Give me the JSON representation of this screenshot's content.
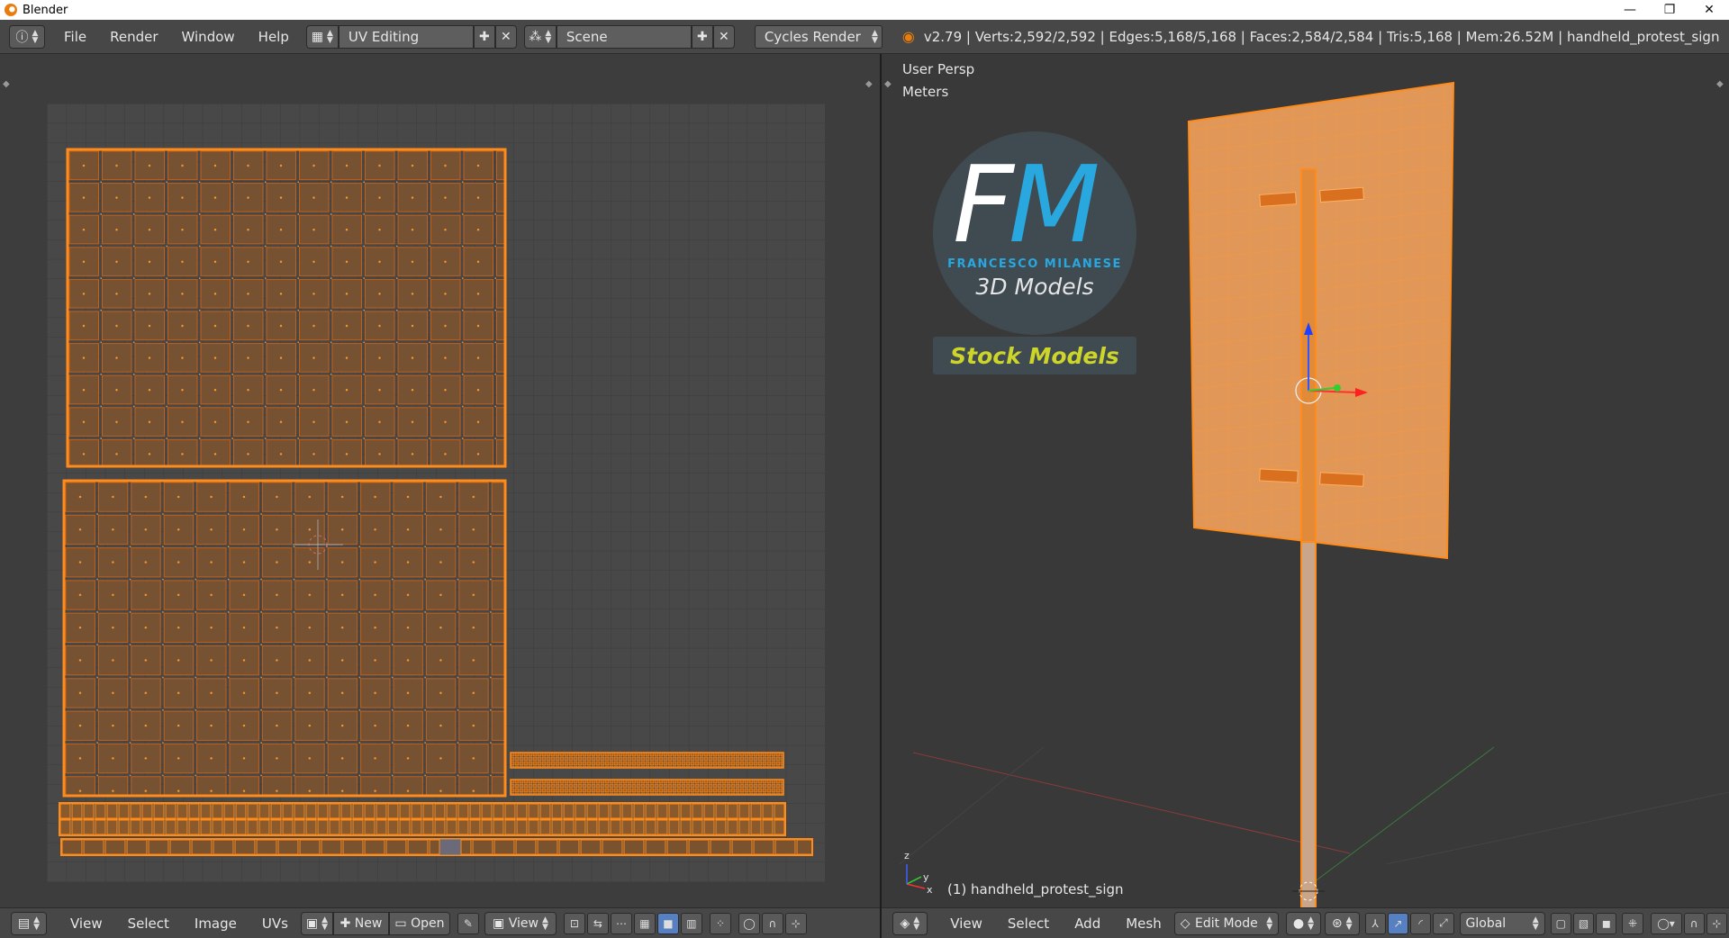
{
  "window": {
    "title": "Blender",
    "minimize": "—",
    "maximize": "❐",
    "close": "✕"
  },
  "header": {
    "menus": [
      "File",
      "Render",
      "Window",
      "Help"
    ],
    "screen_layout": "UV Editing",
    "scene": "Scene",
    "render_engine": "Cycles Render",
    "stats": "v2.79 | Verts:2,592/2,592 | Edges:5,168/5,168 | Faces:2,584/2,584 | Tris:5,168 | Mem:26.52M | handheld_protest_sign"
  },
  "uv_editor": {
    "menus": [
      "View",
      "Select",
      "Image",
      "UVs"
    ],
    "new_label": "New",
    "open_label": "Open",
    "view_label": "View"
  },
  "viewport": {
    "view_name": "User Persp",
    "units": "Meters",
    "object_label": "(1) handheld_protest_sign",
    "menus": [
      "View",
      "Select",
      "Add",
      "Mesh"
    ],
    "mode": "Edit Mode",
    "orientation": "Global",
    "axis_x": "x",
    "axis_y": "y",
    "axis_z": "z"
  },
  "logo": {
    "letter_f": "F",
    "letter_m": "M",
    "brand": "FRANCESCO MILANESE",
    "subtitle": "3D Models",
    "badge": "Stock Models"
  },
  "colors": {
    "uv_selected": "#ff8c1a",
    "mesh_face": "#f0a05a",
    "background": "#3d3d3d",
    "header": "#474747",
    "accent_blue": "#29a7df",
    "badge_yellow": "#cdd52a"
  }
}
